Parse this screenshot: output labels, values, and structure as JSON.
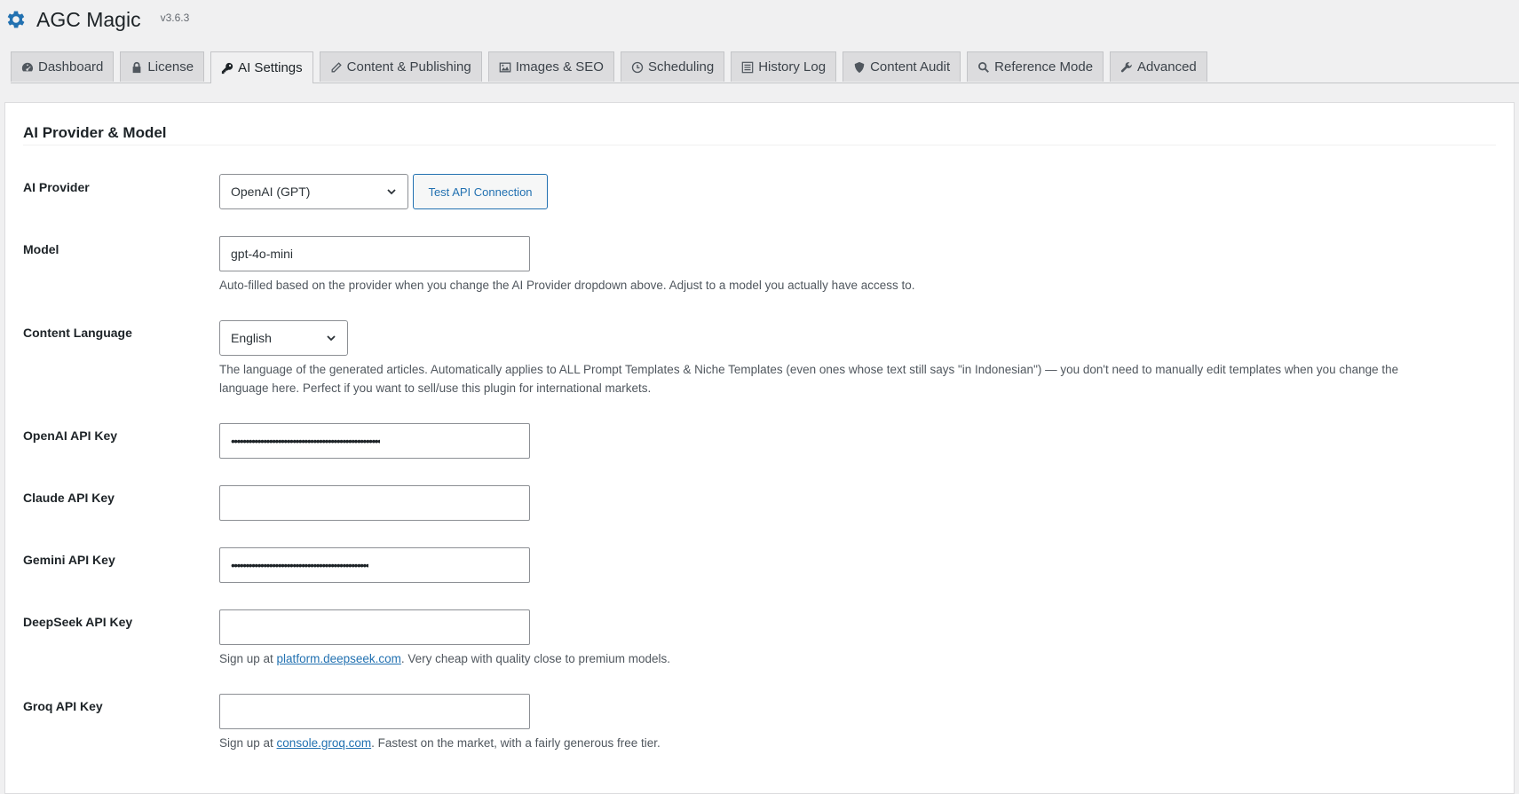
{
  "header": {
    "title": "AGC Magic",
    "version": "v3.6.3",
    "icon": "gear-icon",
    "accent": "#2271b1"
  },
  "tabs": [
    {
      "label": "Dashboard",
      "icon": "dashboard-icon"
    },
    {
      "label": "License",
      "icon": "lock-icon"
    },
    {
      "label": "AI Settings",
      "icon": "key-icon",
      "active": true
    },
    {
      "label": "Content & Publishing",
      "icon": "pencil-icon"
    },
    {
      "label": "Images & SEO",
      "icon": "image-icon"
    },
    {
      "label": "Scheduling",
      "icon": "clock-icon"
    },
    {
      "label": "History Log",
      "icon": "list-icon"
    },
    {
      "label": "Content Audit",
      "icon": "shield-icon"
    },
    {
      "label": "Reference Mode",
      "icon": "search-icon"
    },
    {
      "label": "Advanced",
      "icon": "wrench-icon"
    }
  ],
  "section": {
    "title": "AI Provider & Model"
  },
  "fields": {
    "provider": {
      "label": "AI Provider",
      "value": "OpenAI (GPT)",
      "test_button": "Test API Connection"
    },
    "model": {
      "label": "Model",
      "value": "gpt-4o-mini",
      "description": "Auto-filled based on the provider when you change the AI Provider dropdown above. Adjust to a model you actually have access to."
    },
    "language": {
      "label": "Content Language",
      "value": "English",
      "description_line1": "The language of the generated articles. Automatically applies to ALL Prompt Templates & Niche Templates (even ones whose text still says \"in Indonesian\") — you don't need to manually edit templates when you change the",
      "description_line2": "language here. Perfect if you want to sell/use this plugin for international markets."
    },
    "openai_key": {
      "label": "OpenAI API Key",
      "value": "•••••••••••••••••••••••••••••••••••••••••••••••••••"
    },
    "claude_key": {
      "label": "Claude API Key",
      "value": ""
    },
    "gemini_key": {
      "label": "Gemini API Key",
      "value": "•••••••••••••••••••••••••••••••••••••••••••••••"
    },
    "deepseek_key": {
      "label": "DeepSeek API Key",
      "value": "",
      "desc_prefix": "Sign up at ",
      "link": "platform.deepseek.com",
      "desc_suffix": ". Very cheap with quality close to premium models."
    },
    "groq_key": {
      "label": "Groq API Key",
      "value": "",
      "desc_prefix": "Sign up at ",
      "link": "console.groq.com",
      "desc_suffix": ". Fastest on the market, with a fairly generous free tier."
    }
  }
}
